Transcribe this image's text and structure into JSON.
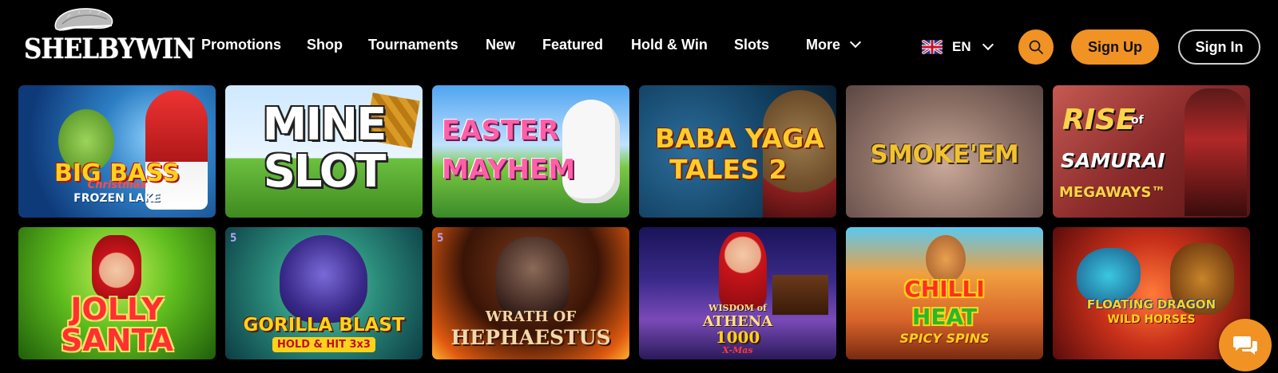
{
  "brand": {
    "name": "SHELBYWIN",
    "accent": "#f19224"
  },
  "nav": [
    {
      "label": "Promotions"
    },
    {
      "label": "Shop"
    },
    {
      "label": "Tournaments"
    },
    {
      "label": "New"
    },
    {
      "label": "Featured"
    },
    {
      "label": "Hold & Win"
    },
    {
      "label": "Slots"
    },
    {
      "label": "More"
    }
  ],
  "language": {
    "code": "EN",
    "flag": "uk-flag-icon"
  },
  "actions": {
    "search_icon": "search-icon",
    "signup_label": "Sign Up",
    "signin_label": "Sign In"
  },
  "games": [
    {
      "title": "BIG BASS",
      "subtitle": "Christmas",
      "extra": "FROZEN LAKE"
    },
    {
      "title": "MINE",
      "subtitle": "SLOT"
    },
    {
      "title": "EASTER",
      "subtitle": "MAYHEM"
    },
    {
      "title": "BABA YAGA",
      "subtitle": "TALES 2"
    },
    {
      "title": "SMOKE'EM"
    },
    {
      "title": "RISE",
      "subtitle": "of",
      "extra": "SAMURAI",
      "extra2": "MEGAWAYS™"
    },
    {
      "title": "JOLLY",
      "subtitle": "SANTA"
    },
    {
      "badge": "5",
      "title": "GORILLA BLAST",
      "subtitle": "HOLD & HIT 3x3"
    },
    {
      "badge": "5",
      "title": "WRATH OF",
      "subtitle": "HEPHAESTUS"
    },
    {
      "title": "WISDOM of",
      "subtitle": "ATHENA",
      "extra": "1000",
      "extra2": "X-Mas"
    },
    {
      "title": "CHILLI",
      "subtitle": "HEAT",
      "extra": "SPICY SPINS"
    },
    {
      "title": "FLOATING DRAGON",
      "subtitle": "WILD HORSES"
    }
  ],
  "chat": {
    "icon": "chat-icon"
  }
}
